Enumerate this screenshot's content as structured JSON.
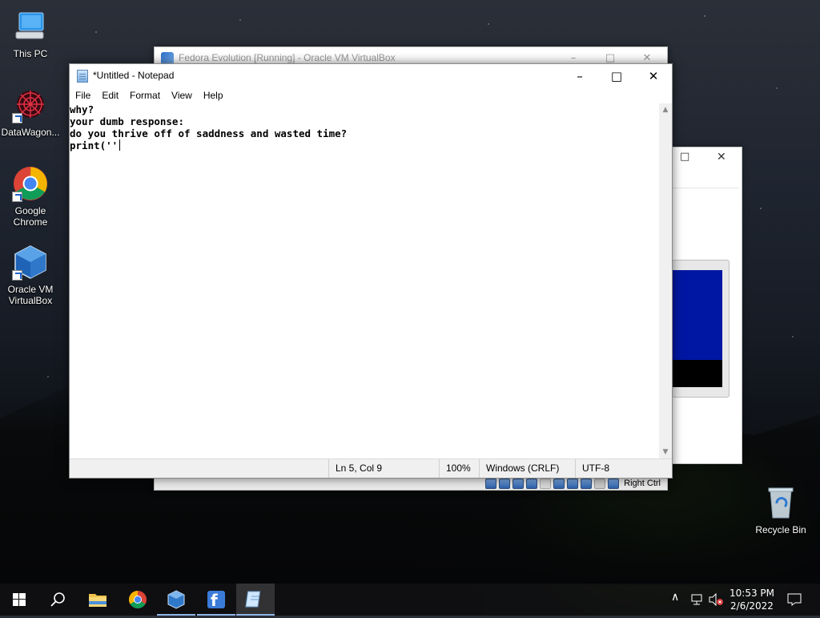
{
  "desktop": {
    "icons": [
      {
        "label": "This PC",
        "icon": "this-pc-icon"
      },
      {
        "label": "DataWagon...",
        "icon": "datawagon-icon"
      },
      {
        "label": "Google Chrome",
        "icon": "chrome-icon"
      },
      {
        "label": "Oracle VM VirtualBox",
        "icon": "virtualbox-icon"
      },
      {
        "label": "Recycle Bin",
        "icon": "recycle-bin-icon"
      }
    ]
  },
  "virtualbox_window": {
    "title": "Fedora Evolution [Running] - Oracle VM VirtualBox",
    "host_key": "Right Ctrl"
  },
  "notepad": {
    "title": "*Untitled - Notepad",
    "menu": [
      "File",
      "Edit",
      "Format",
      "View",
      "Help"
    ],
    "lines": [
      "why?",
      "your dumb response:",
      "do you thrive off of saddness and wasted time?",
      "",
      "print(''"
    ],
    "status": {
      "position": "Ln 5, Col 9",
      "zoom": "100%",
      "line_endings": "Windows (CRLF)",
      "encoding": "UTF-8"
    }
  },
  "taskbar": {
    "apps": [
      "start",
      "search",
      "file-explorer",
      "chrome",
      "virtualbox",
      "fedora",
      "notepad"
    ],
    "clock_time": "10:53 PM",
    "clock_date": "2/6/2022"
  }
}
